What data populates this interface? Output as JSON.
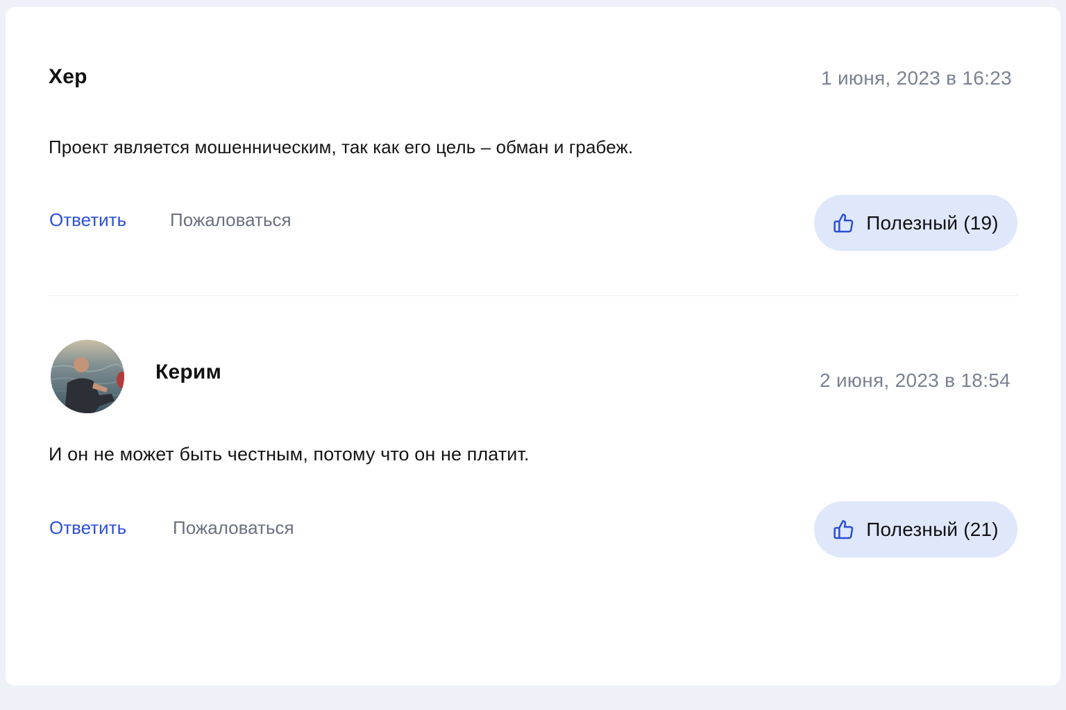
{
  "comments": [
    {
      "author": "Хер",
      "date": "1 июня, 2023 в 16:23",
      "text": "Проект является мошенническим, так как его цель – обман и грабеж.",
      "reply_label": "Ответить",
      "report_label": "Пожаловаться",
      "helpful_label": "Полезный (19)",
      "has_avatar": false
    },
    {
      "author": "Керим",
      "date": "2 июня, 2023 в 18:54",
      "text": "И он не может быть честным, потому что он не платит.",
      "reply_label": "Ответить",
      "report_label": "Пожаловаться",
      "helpful_label": "Полезный (21)",
      "has_avatar": true,
      "avatar_icon": "user-photo-avatar"
    }
  ],
  "icons": {
    "helpful": "thumbs-up-icon"
  },
  "colors": {
    "background": "#eef1f8",
    "card": "#ffffff",
    "link": "#2b4fd8",
    "muted": "#6b7080",
    "date": "#7a8192",
    "helpful_bg": "#dfe7fb",
    "thumb_icon": "#2b4fd8"
  }
}
